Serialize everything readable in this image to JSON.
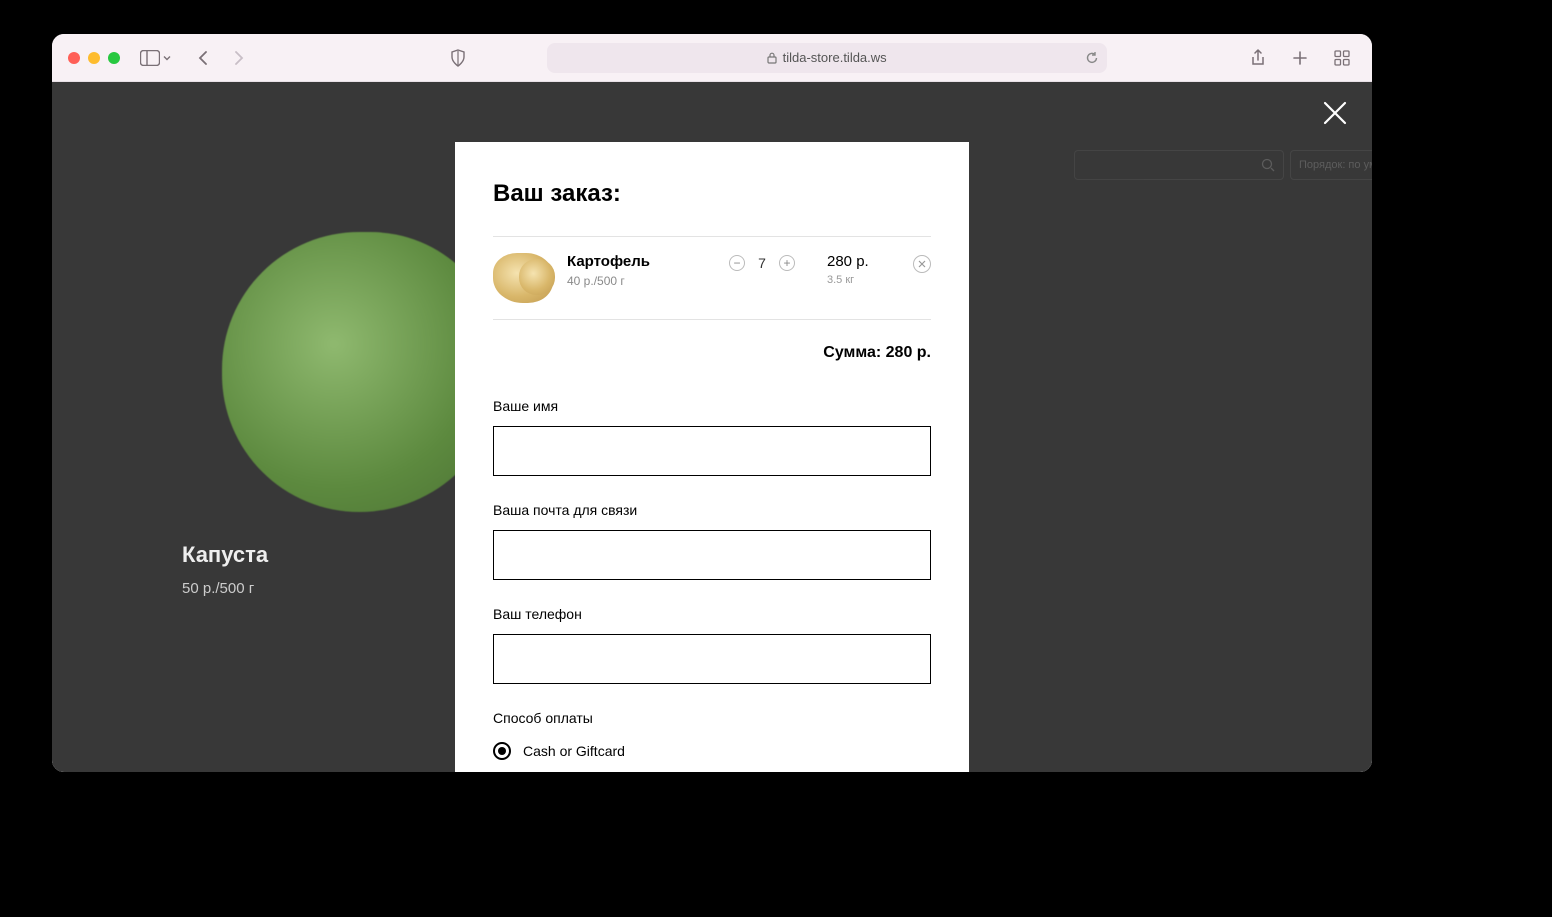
{
  "browser": {
    "url": "tilda-store.tilda.ws"
  },
  "background": {
    "product_title": "Капуста",
    "product_price": "50 р./500 г",
    "sort_label": "Порядок: по умолчанию"
  },
  "modal": {
    "title": "Ваш заказ:",
    "item": {
      "name": "Картофель",
      "unit_price": "40 р./500 г",
      "quantity": "7",
      "line_total": "280 р.",
      "weight": "3.5 кг"
    },
    "total_label": "Сумма: 280 р.",
    "fields": {
      "name_label": "Ваше имя",
      "email_label": "Ваша почта для связи",
      "phone_label": "Ваш телефон"
    },
    "payment": {
      "section_label": "Способ оплаты",
      "option1": "Cash or Giftcard"
    }
  }
}
